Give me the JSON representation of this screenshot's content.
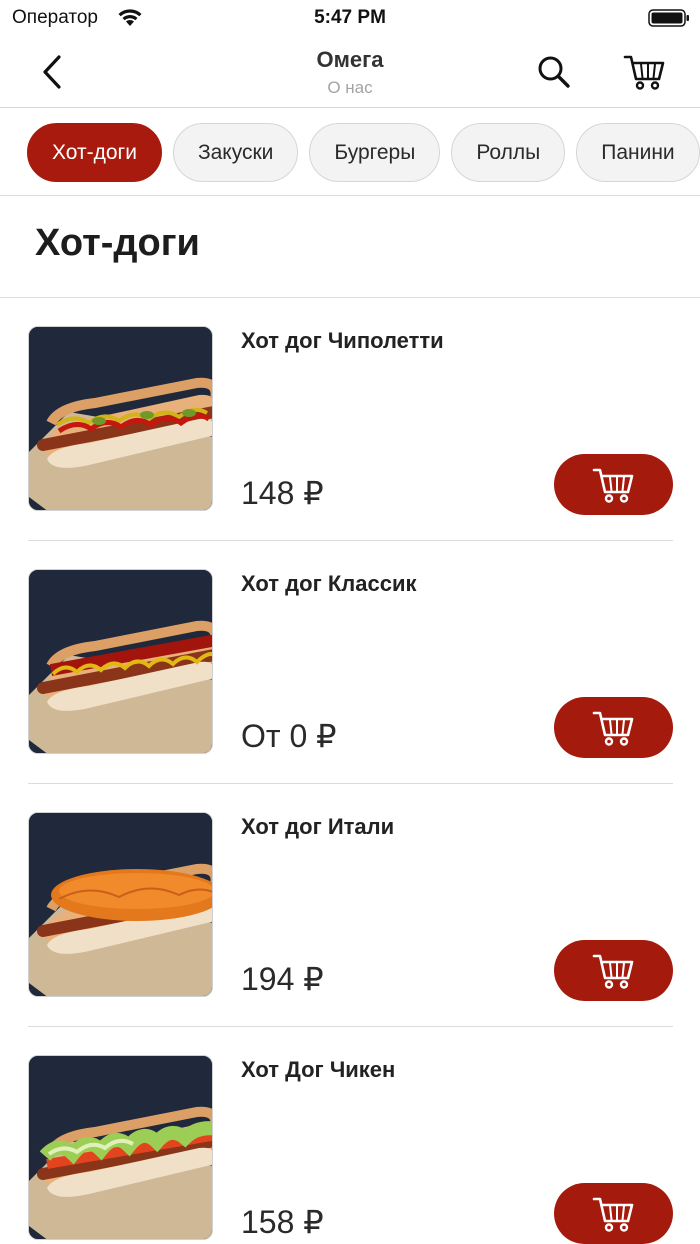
{
  "status_bar": {
    "carrier": "Оператор",
    "time": "5:47 PM"
  },
  "nav": {
    "title": "Омега",
    "subtitle": "О нас",
    "icons": {
      "back": "chevron-left-icon",
      "search": "search-icon",
      "cart": "cart-icon"
    }
  },
  "categories": [
    {
      "label": "Хот-доги",
      "active": true
    },
    {
      "label": "Закуски",
      "active": false
    },
    {
      "label": "Бургеры",
      "active": false
    },
    {
      "label": "Роллы",
      "active": false
    },
    {
      "label": "Панини",
      "active": false
    }
  ],
  "section": {
    "title": "Хот-доги"
  },
  "products": [
    {
      "name": "Хот дог Чиполетти",
      "price": "148 ₽",
      "topping": "ketchup-mustard-pickles"
    },
    {
      "name": "Хот дог Классик",
      "price": "От 0 ₽",
      "topping": "ketchup-mustard"
    },
    {
      "name": "Хот дог Итали",
      "price": "194 ₽",
      "topping": "carrot"
    },
    {
      "name": "Хот Дог Чикен",
      "price": "158 ₽",
      "topping": "lettuce-tomato"
    }
  ],
  "colors": {
    "accent": "#a81a0e",
    "chip_bg": "#f3f3f3",
    "divider": "#dcdcdc",
    "subtitle": "#a3a3a3"
  }
}
